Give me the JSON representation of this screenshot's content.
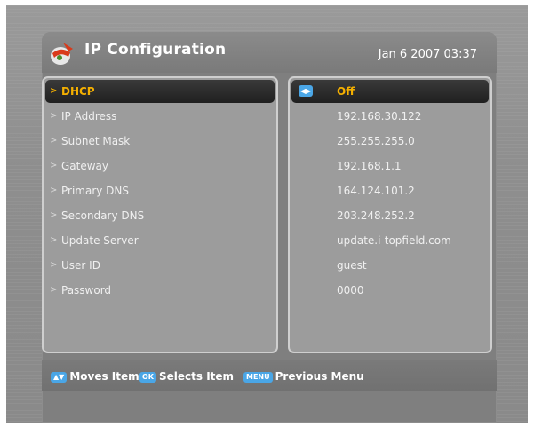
{
  "header": {
    "title": "IP Configuration",
    "datetime": "Jan 6 2007 03:37",
    "icon": "satellite-receiver-logo-icon"
  },
  "settings": [
    {
      "label": "DHCP",
      "value": "Off",
      "selected": true
    },
    {
      "label": "IP Address",
      "value": "192.168.30.122"
    },
    {
      "label": "Subnet Mask",
      "value": "255.255.255.0"
    },
    {
      "label": "Gateway",
      "value": "192.168.1.1"
    },
    {
      "label": "Primary DNS",
      "value": "164.124.101.2"
    },
    {
      "label": "Secondary DNS",
      "value": "203.248.252.2"
    },
    {
      "label": "Update Server",
      "value": "update.i-topfield.com"
    },
    {
      "label": "User ID",
      "value": "guest"
    },
    {
      "label": "Password",
      "value": "0000"
    }
  ],
  "value_key_icon": "left-right-arrows-icon",
  "footer": {
    "moves_key": "up-down-arrows-icon",
    "moves_label": "Moves Item",
    "ok_key": "OK",
    "ok_label": "Selects Item",
    "menu_key": "MENU",
    "menu_label": "Previous Menu"
  },
  "colors": {
    "highlight_text": "#f5b000",
    "highlight_bg": "#202020",
    "key_blue": "#4aa6e6"
  }
}
